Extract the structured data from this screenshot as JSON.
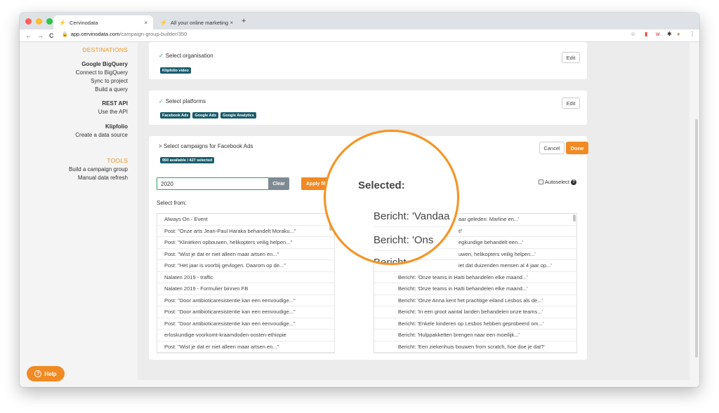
{
  "browser": {
    "tabs": [
      {
        "title": "Cervinodata",
        "close": "×"
      },
      {
        "title": "All your online marketing data",
        "close": "×"
      }
    ],
    "new_tab": "+",
    "url_host": "app.cervinodata.com",
    "url_path": "/campaign-group-builder/350",
    "back": "←",
    "forward": "→",
    "reload": "C"
  },
  "sidebar": {
    "destinations": "DESTINATIONS",
    "google_bigquery": "Google BigQuery",
    "connect_bigquery": "Connect to BigQuery",
    "sync_project": "Sync to project",
    "build_query": "Build a query",
    "rest_api": "REST API",
    "use_api": "Use the API",
    "klipfolio": "Klipfolio",
    "create_source": "Create a data source",
    "tools": "TOOLS",
    "build_campaign_group": "Build a campaign group",
    "manual_refresh": "Manual data refresh",
    "help": "Help"
  },
  "organisation": {
    "title": "Select organisation",
    "tag": "Klipfolio video",
    "edit": "Edit"
  },
  "platforms": {
    "title": "Select platforms",
    "tags": [
      "Facebook Ads",
      "Google Ads",
      "Google Analytics"
    ],
    "edit": "Edit"
  },
  "campaigns": {
    "title": "> Select campaigns for Facebook Ads",
    "badge": "950 available / 427 selected",
    "cancel": "Cancel",
    "done": "Done",
    "search_value": "2020",
    "clear": "Clear",
    "apply": "Apply filt",
    "autoselect": "Autoselect",
    "select_from_label": "Select from:",
    "select_from": [
      "Always On - Event",
      "Post: \"Onze arts Jean-Paul Haraka behandelt Moraku...\"",
      "Post: \"Klinieken opbouwen, helikopters veilig helpen...\"",
      "Post: \"Wist je dat er niet alleen maar artsen en...\"",
      "Post: \"Het jaar is voorbij gevlogen. Daarom op de...\"",
      "Nalaten 2019 - traffic",
      "Nalaten 2019 - Formulier binnen FB",
      "Post: \"Door antibioticaresistentie kan een eenvoudige...\"",
      "Post: \"Door antibioticaresistentie kan een eenvoudige...\"",
      "Post: \"Door antibioticaresistentie kan een eenvoudige...\"",
      "erloskundige-voorkomt-kraamdoden-oosten-ethiopie",
      "Post: \"Wist je dat er niet alleen maar artsen en...\""
    ],
    "selected": [
      "aar geleden: Marline en...'",
      "t!'",
      "egkundige behandelt een...'",
      "uwen, helikopters veilig helpen...'",
      "iet dat duizenden mensen al 4 jaar op...'",
      "Bericht: 'Onze teams in Haïti behandelen elke maand...'",
      "Bericht: 'Onze teams in Haïti behandelen elke maand...'",
      "Bericht: 'Onze Anna kent het prachtige eiland Lesbos als de...'",
      "Bericht: 'In een groot aantal landen behandelen onze teams...'",
      "Bericht: 'Enkele kinderen op Lesbos hebben geprobeerd om...'",
      "Bericht: 'Hulppakketten brengen naar een moeilijk...'",
      "Bericht: 'Een ziekenhuis bouwen from scratch, hoe doe je dat?'"
    ]
  },
  "magnifier": {
    "title": "Selected:",
    "rows": [
      "Bericht: 'Vandaa",
      "Bericht: 'Ons",
      "Bericht"
    ]
  }
}
